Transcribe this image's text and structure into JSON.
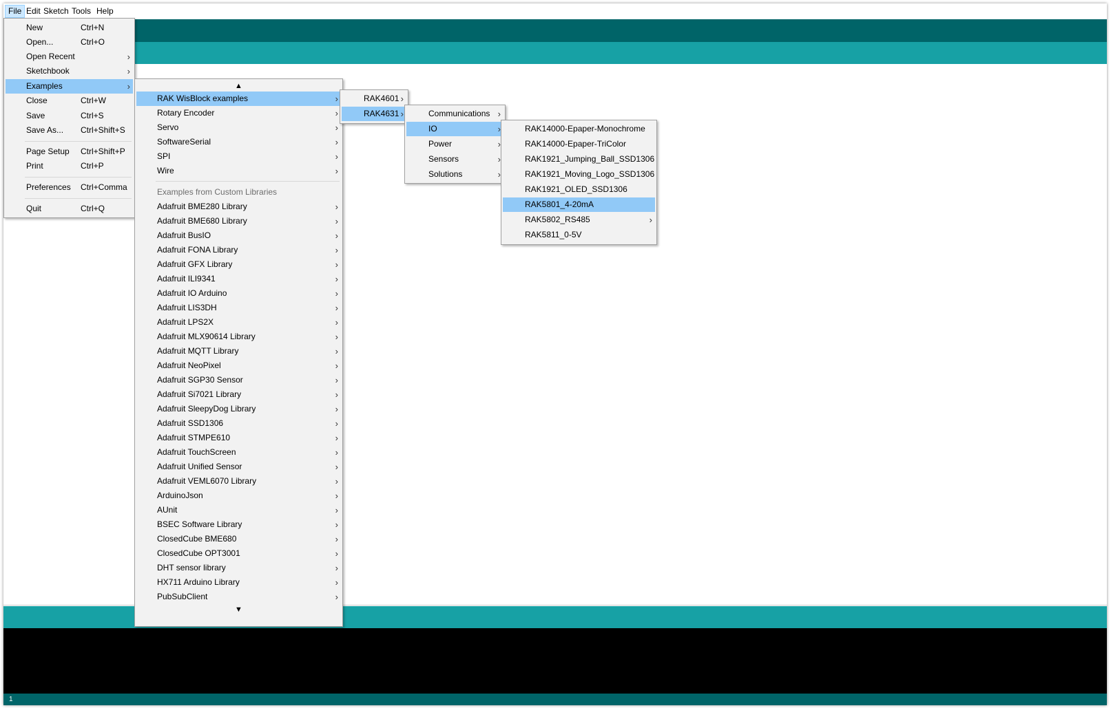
{
  "menubar": {
    "items": [
      {
        "label": "File",
        "active": true
      },
      {
        "label": "Edit"
      },
      {
        "label": "Sketch"
      },
      {
        "label": "Tools"
      },
      {
        "label": "Help"
      }
    ]
  },
  "file_menu": {
    "items": [
      {
        "label": "New",
        "shortcut": "Ctrl+N"
      },
      {
        "label": "Open...",
        "shortcut": "Ctrl+O"
      },
      {
        "label": "Open Recent",
        "shortcut": ""
      },
      {
        "label": "Sketchbook",
        "shortcut": ""
      },
      {
        "label": "Examples",
        "shortcut": ""
      },
      {
        "label": "Close",
        "shortcut": "Ctrl+W"
      },
      {
        "label": "Save",
        "shortcut": "Ctrl+S"
      },
      {
        "label": "Save As...",
        "shortcut": "Ctrl+Shift+S"
      },
      {
        "label": "Page Setup",
        "shortcut": "Ctrl+Shift+P"
      },
      {
        "label": "Print",
        "shortcut": "Ctrl+P"
      },
      {
        "label": "Preferences",
        "shortcut": "Ctrl+Comma"
      },
      {
        "label": "Quit",
        "shortcut": "Ctrl+Q"
      }
    ]
  },
  "examples_menu": {
    "scroll_up": "▲",
    "scroll_down": "▼",
    "top_items": [
      "RAK WisBlock examples",
      "Rotary Encoder",
      "Servo",
      "SoftwareSerial",
      "SPI",
      "Wire"
    ],
    "custom_header": "Examples from Custom Libraries",
    "custom_items": [
      "Adafruit BME280 Library",
      "Adafruit BME680 Library",
      "Adafruit BusIO",
      "Adafruit FONA Library",
      "Adafruit GFX Library",
      "Adafruit ILI9341",
      "Adafruit IO Arduino",
      "Adafruit LIS3DH",
      "Adafruit LPS2X",
      "Adafruit MLX90614 Library",
      "Adafruit MQTT Library",
      "Adafruit NeoPixel",
      "Adafruit SGP30 Sensor",
      "Adafruit Si7021 Library",
      "Adafruit SleepyDog Library",
      "Adafruit SSD1306",
      "Adafruit STMPE610",
      "Adafruit TouchScreen",
      "Adafruit Unified Sensor",
      "Adafruit VEML6070 Library",
      "ArduinoJson",
      "AUnit",
      "BSEC Software Library",
      "ClosedCube BME680",
      "ClosedCube OPT3001",
      "DHT sensor library",
      "HX711 Arduino Library",
      "PubSubClient"
    ]
  },
  "board_menu": {
    "items": [
      "RAK4601",
      "RAK4631"
    ]
  },
  "category_menu": {
    "items": [
      "Communications",
      "IO",
      "Power",
      "Sensors",
      "Solutions"
    ]
  },
  "io_menu": {
    "items": [
      "RAK14000-Epaper-Monochrome",
      "RAK14000-Epaper-TriColor",
      "RAK1921_Jumping_Ball_SSD1306",
      "RAK1921_Moving_Logo_SSD1306",
      "RAK1921_OLED_SSD1306",
      "RAK5801_4-20mA",
      "RAK5802_RS485",
      "RAK5811_0-5V"
    ]
  },
  "statusbar": {
    "line": "1"
  },
  "colors": {
    "teal_dark": "#006468",
    "teal": "#17a1a5",
    "selection": "#91c9f7"
  },
  "icons": {
    "submenu": "chevron-right-icon",
    "scroll_up": "scroll-up-arrow-icon",
    "scroll_down": "scroll-down-arrow-icon"
  }
}
